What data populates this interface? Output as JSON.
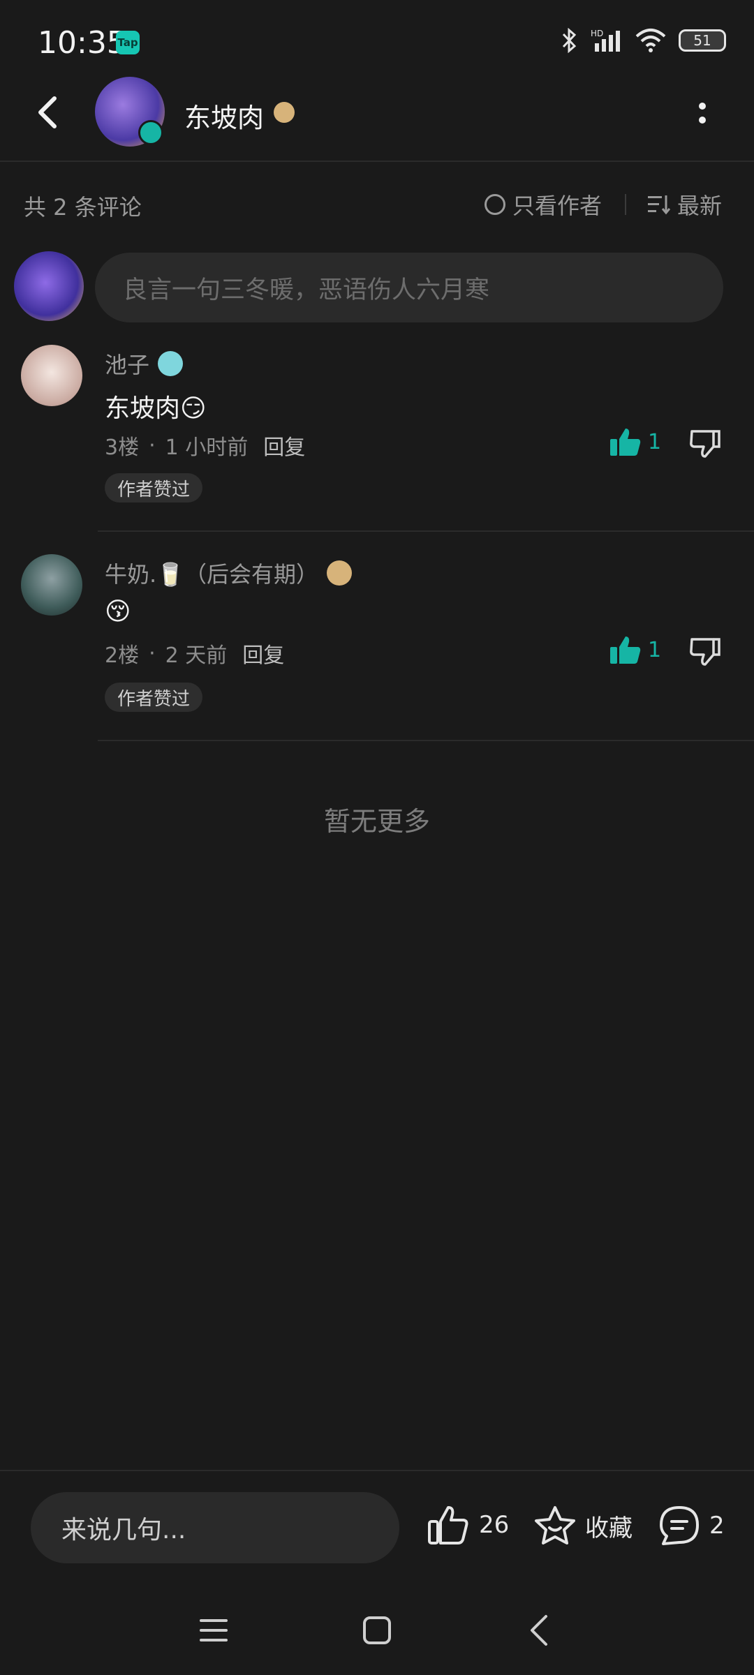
{
  "status": {
    "time": "10:35",
    "app_badge": "Tap",
    "battery": "51"
  },
  "header": {
    "title": "东坡肉"
  },
  "meta": {
    "count": "共 2 条评论",
    "author_only": "只看作者",
    "sort": "最新"
  },
  "composer": {
    "placeholder": "良言一句三冬暖，恶语伤人六月寒"
  },
  "comments": [
    {
      "name": "池子",
      "text": "东坡肉😏",
      "floor": "3楼",
      "time": "1 小时前",
      "reply": "回复",
      "likes": "1",
      "chip": "作者赞过"
    },
    {
      "name": "牛奶.🥛（后会有期）",
      "text": "😚",
      "floor": "2楼",
      "time": "2 天前",
      "reply": "回复",
      "likes": "1",
      "chip": "作者赞过"
    }
  ],
  "no_more": "暂无更多",
  "bottom": {
    "input_placeholder": "来说几句...",
    "likes": "26",
    "favorite": "收藏",
    "comments": "2"
  },
  "colors": {
    "accent": "#16b5a5",
    "background": "#1a1a1a"
  }
}
